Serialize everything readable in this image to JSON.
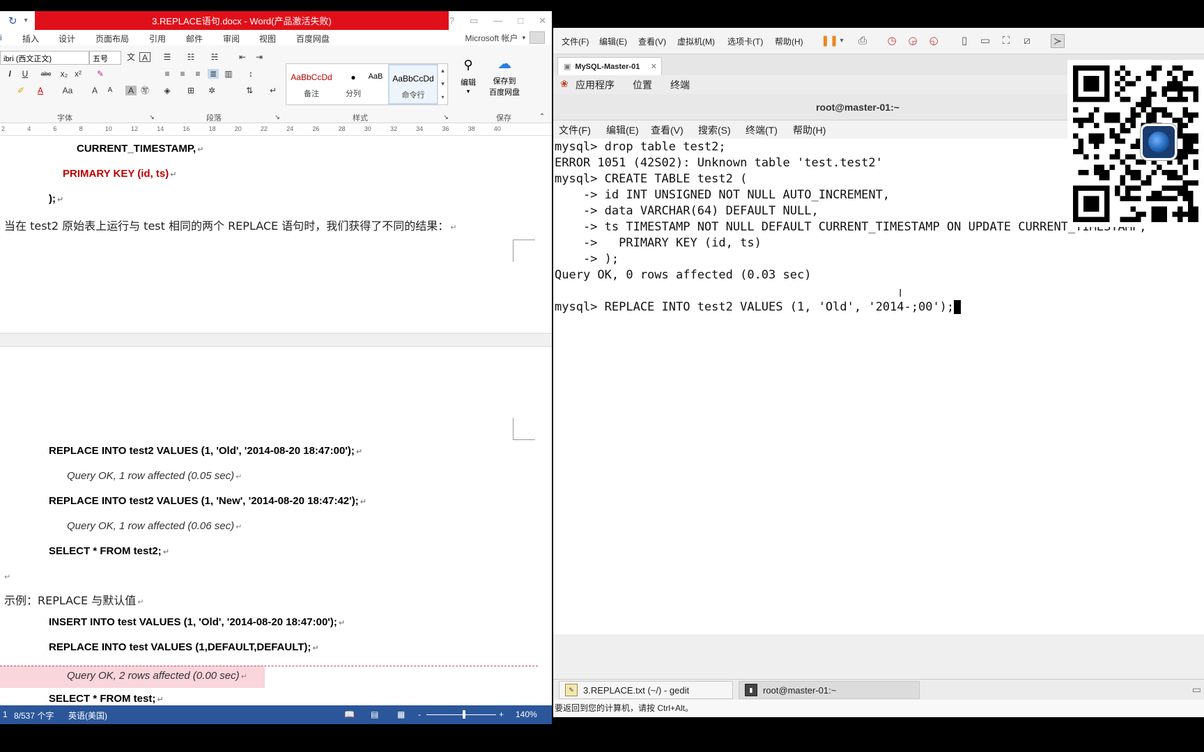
{
  "word": {
    "title": "3.REPLACE语句.docx - Word(产品激活失败)",
    "win_help": "?",
    "tabs": [
      "插入",
      "设计",
      "页面布局",
      "引用",
      "邮件",
      "审阅",
      "视图",
      "百度网盘"
    ],
    "account": "Microsoft 帐户",
    "ribbon": {
      "font_name": "ibri (西文正文)",
      "font_size": "五号",
      "group_font": "字体",
      "group_paragraph": "段落",
      "group_styles": "样式",
      "group_save": "保存",
      "styles": [
        {
          "sample": "AaBbCcDd",
          "name": "备注"
        },
        {
          "sample": "●",
          "name": "分列"
        },
        {
          "sample": "AaBbCcDd",
          "name": "命令行"
        }
      ],
      "style_small": "AaB",
      "edit_label": "编辑",
      "save_to_baidu_1": "保存到",
      "save_to_baidu_2": "百度网盘"
    },
    "ruler": [
      "2",
      "4",
      "6",
      "8",
      "10",
      "12",
      "14",
      "16",
      "18",
      "20",
      "22",
      "24",
      "26",
      "28",
      "30",
      "32",
      "34",
      "36",
      "38",
      "40"
    ],
    "doc": {
      "line_ts": "CURRENT_TIMESTAMP,",
      "line_pk": "PRIMARY KEY (id, ts)",
      "line_close": ");",
      "para_cn": "当在 test2 原始表上运行与 test 相同的两个 REPLACE 语句时，我们获得了不同的结果：",
      "replace1": "REPLACE INTO test2 VALUES (1, 'Old', '2014-08-20 18:47:00');",
      "result1": "Query OK, 1 row affected (0.05 sec)",
      "replace2": "REPLACE INTO test2 VALUES (1, 'New', '2014-08-20 18:47:42');",
      "result2": "Query OK, 1 row affected (0.06 sec)",
      "select2": "SELECT * FROM test2;",
      "example_heading": "示例：REPLACE 与默认值",
      "insert_test": "INSERT INTO test VALUES (1, 'Old', '2014-08-20 18:47:00');",
      "replace_default": "REPLACE INTO test VALUES (1,DEFAULT,DEFAULT);",
      "result3": "Query OK, 2 rows affected (0.00 sec)",
      "select_test": "SELECT * FROM test;"
    },
    "status": {
      "words": "8/537 个字",
      "lang": "英语(美国)",
      "zoom": "140%",
      "zoom_minus": "-",
      "zoom_plus": "+"
    }
  },
  "vm": {
    "menu": [
      "文件(F)",
      "编辑(E)",
      "查看(V)",
      "虚拟机(M)",
      "选项卡(T)",
      "帮助(H)"
    ],
    "tab_label": "MySQL-Master-01",
    "gnome_panel": [
      "应用程序",
      "位置",
      "终端"
    ],
    "terminal_title": "root@master-01:~",
    "terminal_menu": [
      "文件(F)",
      "编辑(E)",
      "查看(V)",
      "搜索(S)",
      "终端(T)",
      "帮助(H)"
    ],
    "terminal_lines": [
      "mysql> drop table test2;",
      "ERROR 1051 (42S02): Unknown table 'test.test2'",
      "mysql> CREATE TABLE test2 (",
      "    -> id INT UNSIGNED NOT NULL AUTO_INCREMENT,",
      "    -> data VARCHAR(64) DEFAULT NULL,",
      "    -> ts TIMESTAMP NOT NULL DEFAULT CURRENT_TIMESTAMP ON UPDATE CURRENT_TIMESTAMP,",
      "    ->   PRIMARY KEY (id, ts)",
      "    -> );",
      "Query OK, 0 rows affected (0.03 sec)",
      "",
      "mysql> REPLACE INTO test2 VALUES (1, 'Old', '2014-;00');"
    ],
    "taskbar": [
      {
        "label": "3.REPLACE.txt (~/) - gedit"
      },
      {
        "label": "root@master-01:~"
      }
    ],
    "status_text": "要返回到您的计算机，请按 Ctrl+Alt。"
  }
}
